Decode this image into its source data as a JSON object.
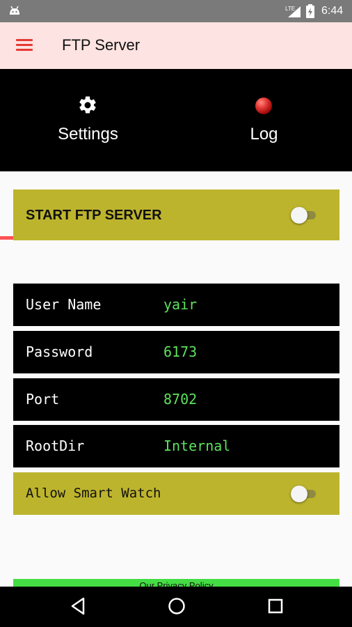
{
  "status_bar": {
    "time": "6:44",
    "network_label": "LTE",
    "icons": [
      "android-icon",
      "signal-icon",
      "battery-icon"
    ]
  },
  "app_bar": {
    "title": "FTP Server",
    "menu_icon": "hamburger-menu-icon"
  },
  "tabs": [
    {
      "label": "Settings",
      "icon": "gear-icon",
      "selected": true
    },
    {
      "label": "Log",
      "icon": "red-status-led-icon",
      "selected": false
    }
  ],
  "start_server": {
    "label": "START FTP SERVER",
    "enabled": false
  },
  "fields": [
    {
      "key": "User Name",
      "value": "yair"
    },
    {
      "key": "Password",
      "value": "6173"
    },
    {
      "key": "Port",
      "value": "8702"
    },
    {
      "key": "RootDir",
      "value": "Internal"
    }
  ],
  "smart_watch": {
    "label": "Allow Smart Watch",
    "enabled": false
  },
  "privacy_link": "Our Privacy Policy",
  "nav_bar": {
    "icons": [
      "back-icon",
      "home-icon",
      "recents-icon"
    ]
  },
  "colors": {
    "accent": "#ff5252",
    "app_bar_bg": "#fde3e1",
    "card_yellow": "#bdb42d",
    "value_green": "#5ee15e",
    "privacy_green": "#44dd44"
  }
}
